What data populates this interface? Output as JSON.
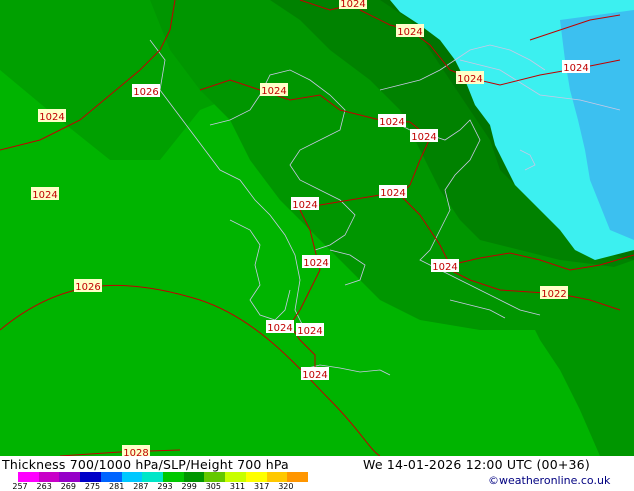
{
  "map": {
    "isobar_labels": [
      {
        "text": "1024"
      },
      {
        "text": "1024"
      },
      {
        "text": "1024"
      },
      {
        "text": "1024"
      },
      {
        "text": "1026"
      },
      {
        "text": "1024"
      },
      {
        "text": "1024"
      },
      {
        "text": "1024"
      },
      {
        "text": "1024"
      },
      {
        "text": "1024"
      },
      {
        "text": "1024"
      },
      {
        "text": "1024"
      },
      {
        "text": "1024"
      },
      {
        "text": "1024"
      },
      {
        "text": "1022"
      },
      {
        "text": "1026"
      },
      {
        "text": "1024"
      },
      {
        "text": "1024"
      },
      {
        "text": "1024"
      },
      {
        "text": "1028"
      }
    ],
    "colors": {
      "green_light": "#00b400",
      "green_mid": "#009600",
      "green_dark": "#007800",
      "cyan": "#3cf0f0",
      "blue_light": "#3cc0f0",
      "coast": "#c8c8e6",
      "isobar": "#c00000"
    }
  },
  "footer": {
    "title": "Thickness 700/1000 hPa/SLP/Height 700 hPa",
    "datetime": "We 14-01-2026 12:00 UTC (00+36)",
    "credit": "©weatheronline.co.uk"
  },
  "legend": {
    "ticks": [
      "257",
      "263",
      "269",
      "275",
      "281",
      "287",
      "293",
      "299",
      "305",
      "311",
      "317",
      "320"
    ],
    "colors": [
      "#ff00ff",
      "#c800c8",
      "#9600c8",
      "#0000c8",
      "#0064ff",
      "#00c8ff",
      "#00e6c8",
      "#00c800",
      "#009600",
      "#64c800",
      "#c8ff00",
      "#ffff00",
      "#ffc800",
      "#ff9600"
    ]
  }
}
